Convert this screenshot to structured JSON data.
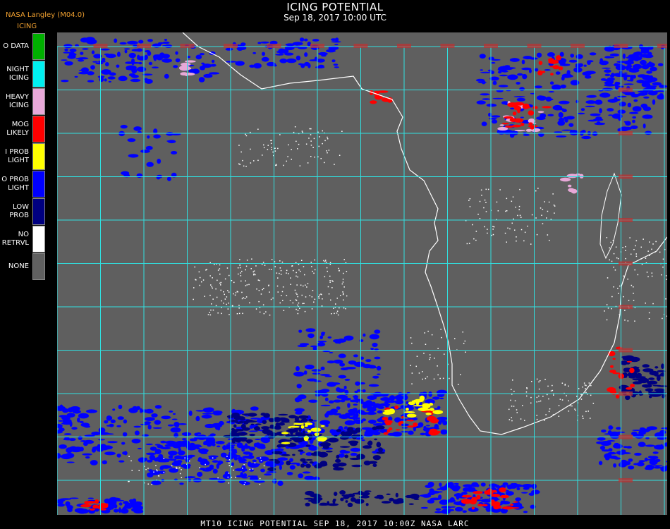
{
  "header": {
    "title": "ICING POTENTIAL",
    "subtitle": "Sep 18, 2017 10:00 UTC",
    "org": "NASA Langley (M04.0)",
    "product": "ICING"
  },
  "legend": [
    {
      "label": "O DATA",
      "color": "#00b000"
    },
    {
      "label": "NIGHT\nICING",
      "color": "#00f0f0"
    },
    {
      "label": "HEAVY\nICING",
      "color": "#e8a8d8"
    },
    {
      "label": "MOG\nLIKELY",
      "color": "#ff0000"
    },
    {
      "label": "I PROB\nLIGHT",
      "color": "#ffff00"
    },
    {
      "label": "O PROB\nLIGHT",
      "color": "#0000ff"
    },
    {
      "label": "LOW\nPROB",
      "color": "#000080"
    },
    {
      "label": "NO\nRETRVL",
      "color": "#ffffff"
    },
    {
      "label": "NONE",
      "color": "#606060"
    }
  ],
  "map": {
    "background": "#5f5f5f",
    "grid_color": "#30e0e0",
    "coast_color": "#ffffff",
    "label_color": "#c03030"
  },
  "footer": "MT10  ICING POTENTIAL   SEP 18, 2017 10:00Z  NASA LARC"
}
